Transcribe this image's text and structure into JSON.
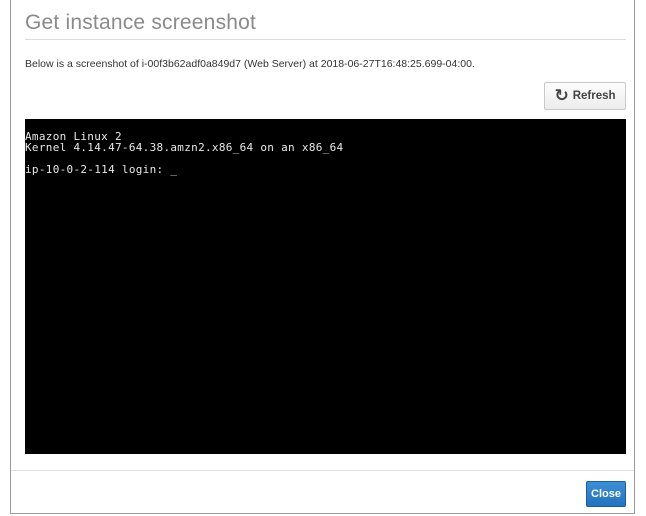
{
  "dialog": {
    "title": "Get instance screenshot",
    "description": "Below is a screenshot of i-00f3b62adf0a849d7 (Web Server) at 2018-06-27T16:48:25.699-04:00.",
    "refresh_label": "Refresh",
    "refresh_icon": "refresh-icon",
    "close_label": "Close",
    "accent_color": "#2a7bc4"
  },
  "console": {
    "line_1": "Amazon Linux 2",
    "line_2": "Kernel 4.14.47-64.38.amzn2.x86_64 on an x86_64",
    "prompt": "ip-10-0-2-114 login: ",
    "cursor": "_"
  }
}
